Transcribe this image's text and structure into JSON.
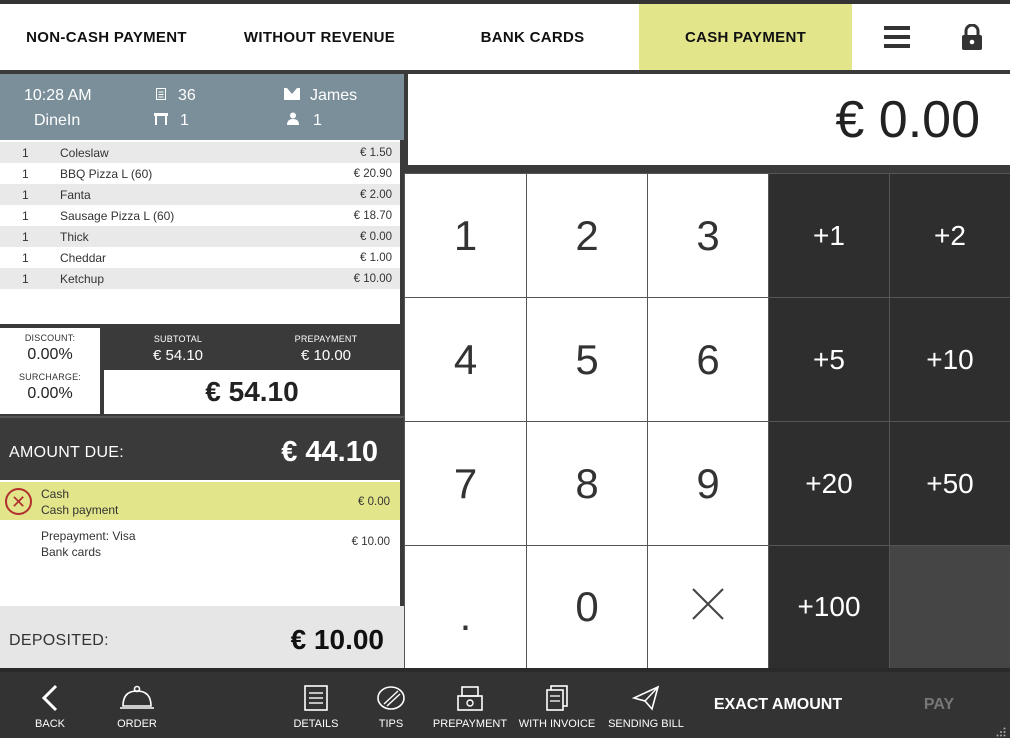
{
  "tabs": {
    "non_cash": "NON-CASH PAYMENT",
    "without_revenue": "WITHOUT REVENUE",
    "bank_cards": "BANK CARDS",
    "cash_payment": "CASH PAYMENT",
    "active": "CASH PAYMENT"
  },
  "order_info": {
    "time": "10:28 AM",
    "mode": "DineIn",
    "receipt_number": "36",
    "table_number": "1",
    "waiter": "James",
    "guests": "1"
  },
  "items": [
    {
      "qty": "1",
      "name": "Coleslaw",
      "price": "€ 1.50"
    },
    {
      "qty": "1",
      "name": "BBQ Pizza L (60)",
      "price": "€ 20.90"
    },
    {
      "qty": "1",
      "name": "Fanta",
      "price": "€ 2.00"
    },
    {
      "qty": "1",
      "name": "Sausage Pizza L (60)",
      "price": "€ 18.70"
    },
    {
      "qty": "1",
      "name": "Thick",
      "price": "€ 0.00"
    },
    {
      "qty": "1",
      "name": "Cheddar",
      "price": "€ 1.00"
    },
    {
      "qty": "1",
      "name": "Ketchup",
      "price": "€ 10.00"
    }
  ],
  "totals": {
    "discount_label": "DISCOUNT:",
    "discount": "0.00%",
    "surcharge_label": "SURCHARGE:",
    "surcharge": "0.00%",
    "subtotal_label": "SUBTOTAL",
    "subtotal": "€ 54.10",
    "prepayment_label": "PREPAYMENT",
    "prepayment": "€ 10.00",
    "total": "€ 54.10"
  },
  "amount_due": {
    "label": "AMOUNT DUE:",
    "value": "€ 44.10"
  },
  "payments": [
    {
      "line1": "Cash",
      "line2": "Cash payment",
      "amount": "€ 0.00"
    },
    {
      "line1": "Prepayment: Visa",
      "line2": "Bank cards",
      "amount": "€ 10.00"
    }
  ],
  "deposited": {
    "label": "DEPOSITED:",
    "value": "€ 10.00"
  },
  "display_amount": "€ 0.00",
  "keypad": {
    "digits": [
      "1",
      "2",
      "3",
      "4",
      "5",
      "6",
      "7",
      "8",
      "9",
      ".",
      "0"
    ],
    "quick_adds": [
      "+1",
      "+2",
      "+5",
      "+10",
      "+20",
      "+50",
      "+100"
    ],
    "clear_icon": "x-icon"
  },
  "bottom": {
    "back": "BACK",
    "order": "ORDER",
    "details": "DETAILS",
    "tips": "TIPS",
    "prepayment": "PREPAYMENT",
    "with_invoice": "WITH INVOICE",
    "sending_bill": "SENDING BILL",
    "exact_amount": "EXACT AMOUNT",
    "pay": "PAY"
  },
  "colors": {
    "accent": "#e2e58a",
    "header_info": "#7a8f9a",
    "dark": "#2e2e2e",
    "delete": "#b03030"
  }
}
